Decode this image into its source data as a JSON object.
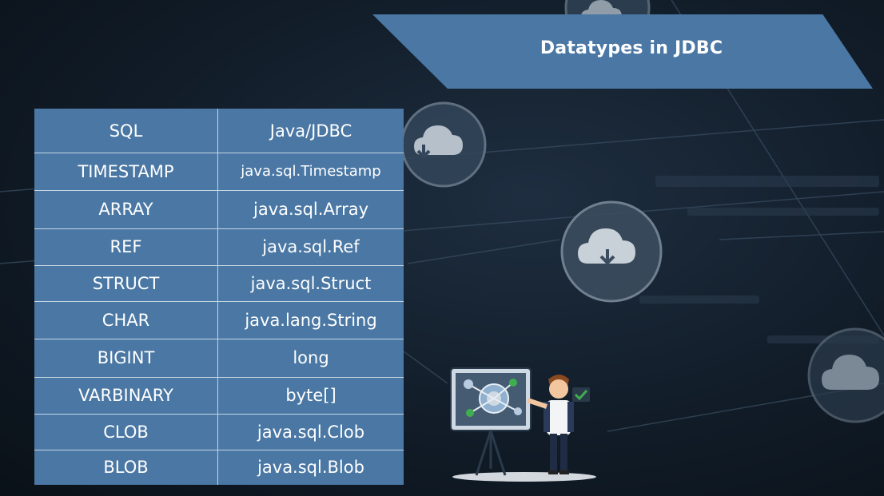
{
  "banner": {
    "title": "Datatypes in JDBC"
  },
  "table": {
    "headers": [
      "SQL",
      "Java/JDBC"
    ],
    "rows": [
      [
        "TIMESTAMP",
        "java.sql.Timestamp"
      ],
      [
        "ARRAY",
        "java.sql.Array"
      ],
      [
        "REF",
        "java.sql.Ref"
      ],
      [
        "STRUCT",
        "java.sql.Struct"
      ],
      [
        "CHAR",
        "java.lang.String"
      ],
      [
        "BIGINT",
        "long"
      ],
      [
        "VARBINARY",
        "byte[]"
      ],
      [
        "CLOB",
        "java.sql.Clob"
      ],
      [
        "BLOB",
        "java.sql.Blob"
      ]
    ]
  },
  "icons": [
    "cloud-download-icon",
    "presenter-illustration",
    "whiteboard-icon",
    "checkmark-icon"
  ],
  "colors": {
    "panel": "#4a77a3",
    "background": "#111c28",
    "text": "#ffffff"
  }
}
